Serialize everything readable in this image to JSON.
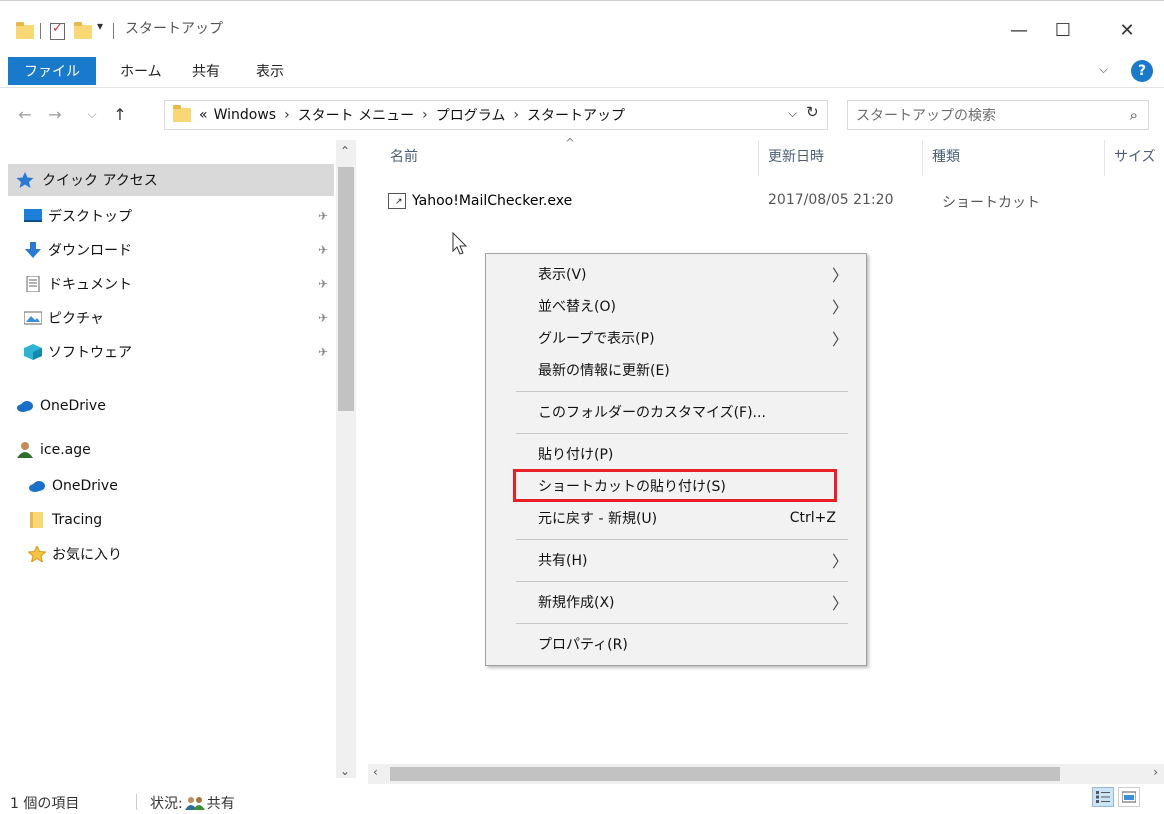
{
  "window": {
    "title": "スタートアップ",
    "qa_dropdown": "▾",
    "minimize": "—",
    "maximize": "☐",
    "close": "✕"
  },
  "ribbon": {
    "tabs": [
      "ファイル",
      "ホーム",
      "共有",
      "表示"
    ],
    "collapse_chevron": "⌵",
    "help": "?"
  },
  "nav_buttons": {
    "back": "←",
    "forward": "→",
    "recent": "⌵",
    "up": "↑"
  },
  "address": {
    "overflow": "«",
    "breadcrumbs": [
      "Windows",
      "スタート メニュー",
      "プログラム",
      "スタートアップ"
    ],
    "separator": "›",
    "dropdown": "⌵",
    "refresh": "↻"
  },
  "search": {
    "placeholder": "スタートアップの検索",
    "icon": "⌕"
  },
  "nav_pane": {
    "quick_access": "クイック アクセス",
    "items": [
      {
        "label": "デスクトップ",
        "icon": "desktop-icon",
        "pinned": true
      },
      {
        "label": "ダウンロード",
        "icon": "download-icon",
        "pinned": true
      },
      {
        "label": "ドキュメント",
        "icon": "document-icon",
        "pinned": true
      },
      {
        "label": "ピクチャ",
        "icon": "picture-icon",
        "pinned": true
      },
      {
        "label": "ソフトウェア",
        "icon": "cube-icon",
        "pinned": true
      }
    ],
    "onedrive": "OneDrive",
    "user": "ice.age",
    "user_children": [
      "OneDrive",
      "Tracing",
      "お気に入り"
    ],
    "pin_glyph": "✈",
    "scroll_up": "⌃",
    "scroll_down": "⌄"
  },
  "file_list": {
    "sort_indicator": "^",
    "columns": [
      "名前",
      "更新日時",
      "種類",
      "サイズ"
    ],
    "rows": [
      {
        "name": "Yahoo!MailChecker.exe",
        "modified": "2017/08/05 21:20",
        "type": "ショートカット"
      }
    ]
  },
  "context_menu": {
    "items": [
      {
        "label": "表示(V)",
        "submenu": true
      },
      {
        "label": "並べ替え(O)",
        "submenu": true
      },
      {
        "label": "グループで表示(P)",
        "submenu": true
      },
      {
        "label": "最新の情報に更新(E)",
        "submenu": false
      },
      {
        "label": "このフォルダーのカスタマイズ(F)...",
        "submenu": false
      },
      {
        "label": "貼り付け(P)",
        "submenu": false
      },
      {
        "label": "ショートカットの貼り付け(S)",
        "submenu": false,
        "highlighted": true
      },
      {
        "label": "元に戻す - 新規(U)",
        "shortcut": "Ctrl+Z"
      },
      {
        "label": "共有(H)",
        "submenu": true
      },
      {
        "label": "新規作成(X)",
        "submenu": true
      },
      {
        "label": "プロパティ(R)",
        "submenu": false
      }
    ],
    "arrow": "〉",
    "highlight_color": "#e81f25"
  },
  "hscroll": {
    "left": "‹",
    "right": "›"
  },
  "status": {
    "count": "1 個の項目",
    "state_label": "状況:",
    "state_value": "共有"
  },
  "colors": {
    "accent": "#1979ca",
    "selected_bg": "#d9d9d9",
    "menu_bg": "#f2f2f2"
  }
}
